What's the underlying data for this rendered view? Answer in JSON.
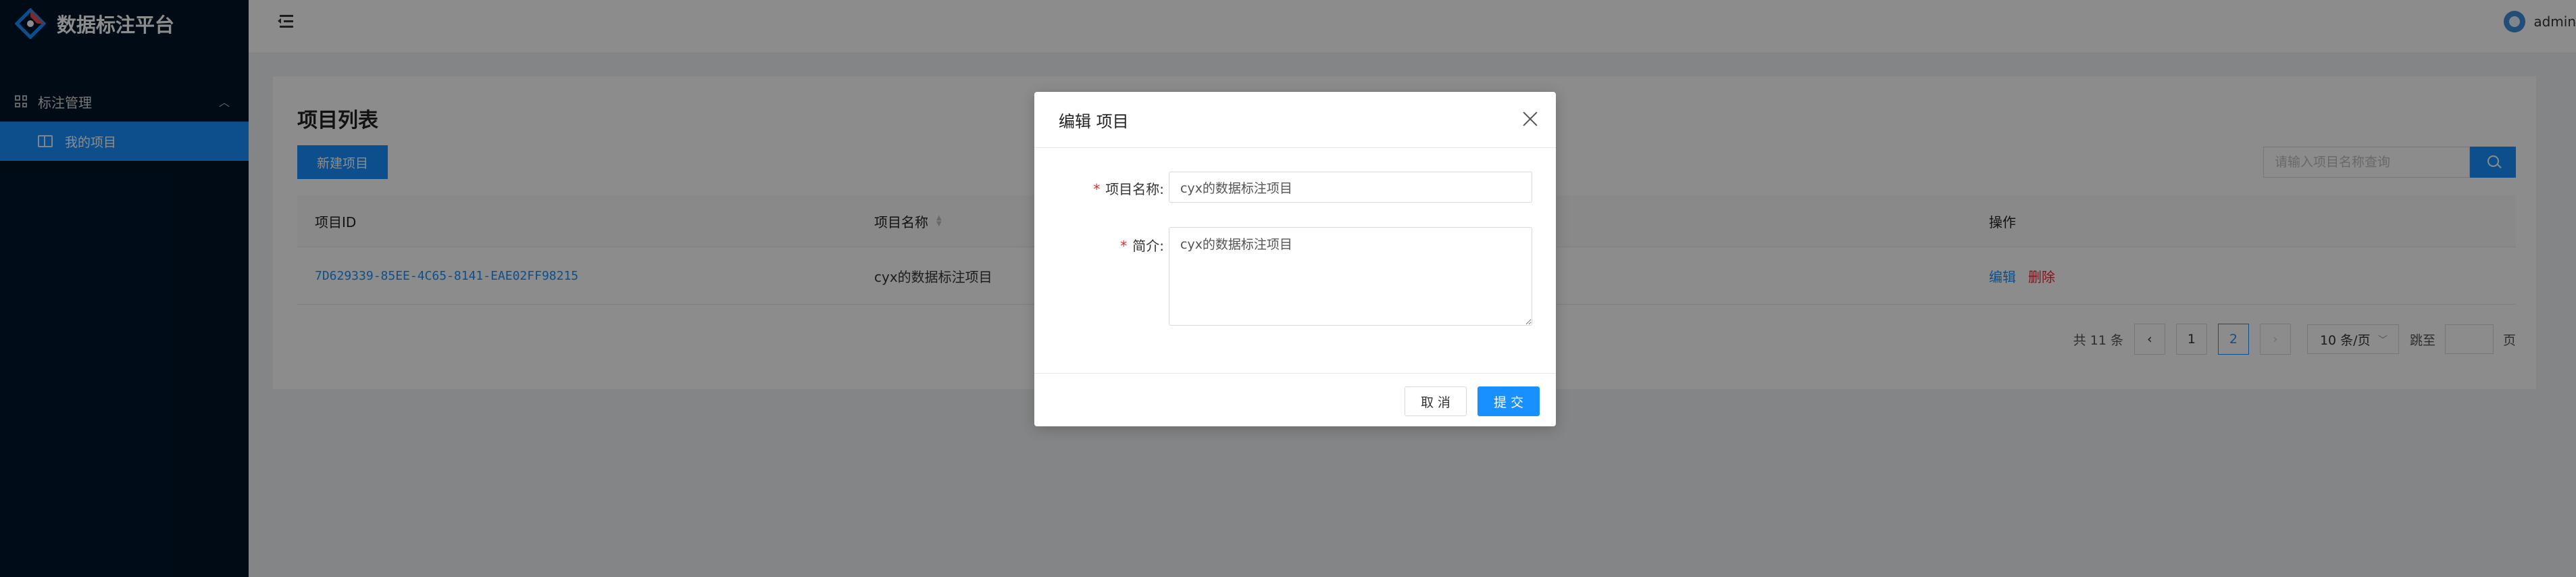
{
  "app": {
    "title": "数据标注平台"
  },
  "sidebar": {
    "group_label": "标注管理",
    "items": [
      {
        "label": "我的项目"
      }
    ]
  },
  "header": {
    "user_name": "admin"
  },
  "page": {
    "title": "项目列表",
    "new_button": "新建项目",
    "search": {
      "placeholder": "请输入项目名称查询",
      "value": ""
    }
  },
  "table": {
    "columns": {
      "id": "项目ID",
      "name": "项目名称",
      "op": "操作"
    },
    "rows": [
      {
        "id": "7D629339-85EE-4C65-8141-EAE02FF98215",
        "name": "cyx的数据标注项目",
        "edit": "编辑",
        "delete": "删除"
      }
    ]
  },
  "pagination": {
    "total_text": "共 11 条",
    "pages": [
      "1",
      "2"
    ],
    "current": "2",
    "prev": "‹",
    "next": "›",
    "page_size": "10 条/页",
    "jump_label": "跳至",
    "page_unit": "页"
  },
  "modal": {
    "title": "编辑 项目",
    "fields": {
      "name": {
        "label": "项目名称:",
        "value": "cyx的数据标注项目"
      },
      "intro": {
        "label": "简介:",
        "value": "cyx的数据标注项目"
      }
    },
    "cancel": "取 消",
    "submit": "提 交"
  },
  "colors": {
    "primary": "#1890ff",
    "sider": "#001529",
    "danger": "#f5222d"
  }
}
